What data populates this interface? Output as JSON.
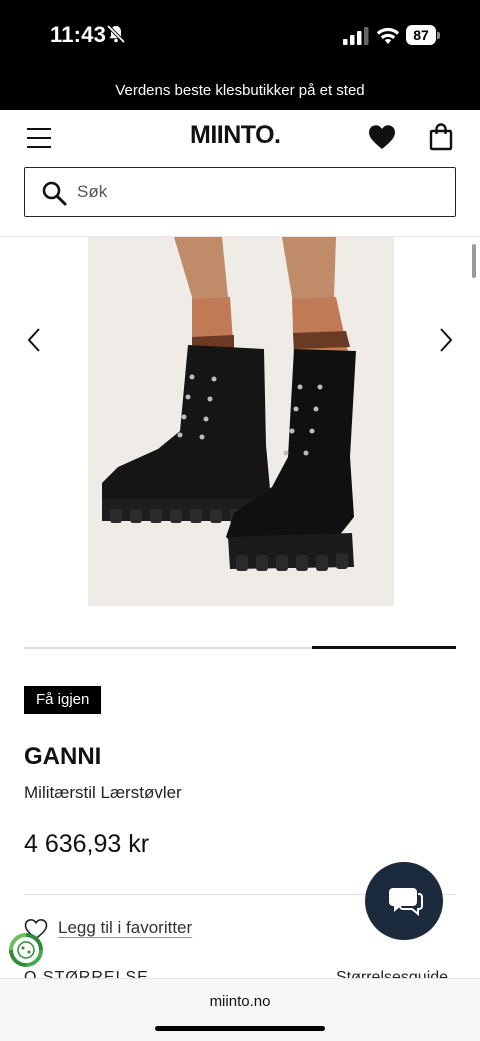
{
  "status_bar": {
    "time": "11:43",
    "battery": "87"
  },
  "promo_banner": "Verdens beste klesbutikker på et sted",
  "header": {
    "logo": "MIINTO."
  },
  "search": {
    "placeholder": "Søk"
  },
  "gallery": {
    "image": "ganni-military-leather-boots",
    "current_index": 3,
    "total": 3
  },
  "product": {
    "badge": "Få igjen",
    "brand": "GANNI",
    "name": "Militærstil Lærstøvler",
    "price": "4 636,93 kr",
    "favorites_label": "Legg til i favoritter",
    "size_label": "Q STØRRELSE",
    "size_guide": "Størrelsesguide"
  },
  "browser": {
    "url": "miinto.no"
  },
  "colors": {
    "primary": "#000000",
    "chat_bubble": "#1c2a3d",
    "eco_green": "#2e8b3a"
  }
}
